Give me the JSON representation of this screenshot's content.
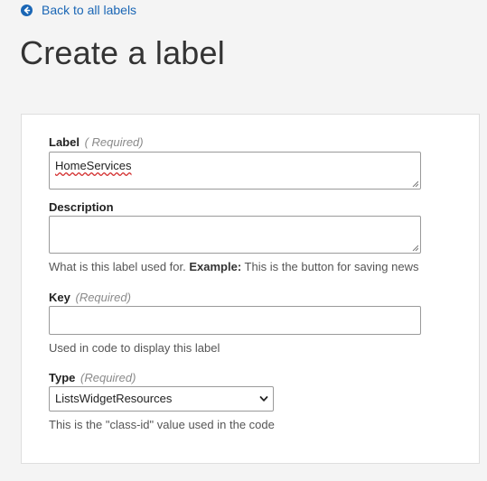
{
  "nav": {
    "back_label": "Back to all labels",
    "back_icon": "arrow-circle-left-icon",
    "accent_color": "#1a66b5"
  },
  "page": {
    "title": "Create a label"
  },
  "form": {
    "label_field": {
      "label": "Label",
      "required": "( Required)",
      "value": "HomeServices"
    },
    "description_field": {
      "label": "Description",
      "value": "",
      "help_prefix": "What is this label used for. ",
      "help_example_label": "Example:",
      "help_example_text": " This is the button for saving news"
    },
    "key_field": {
      "label": "Key",
      "required": "(Required)",
      "value": "",
      "help": "Used in code to display this label"
    },
    "type_field": {
      "label": "Type",
      "required": "(Required)",
      "selected": "ListsWidgetResources",
      "help": "This is the \"class-id\" value used in the code"
    }
  }
}
